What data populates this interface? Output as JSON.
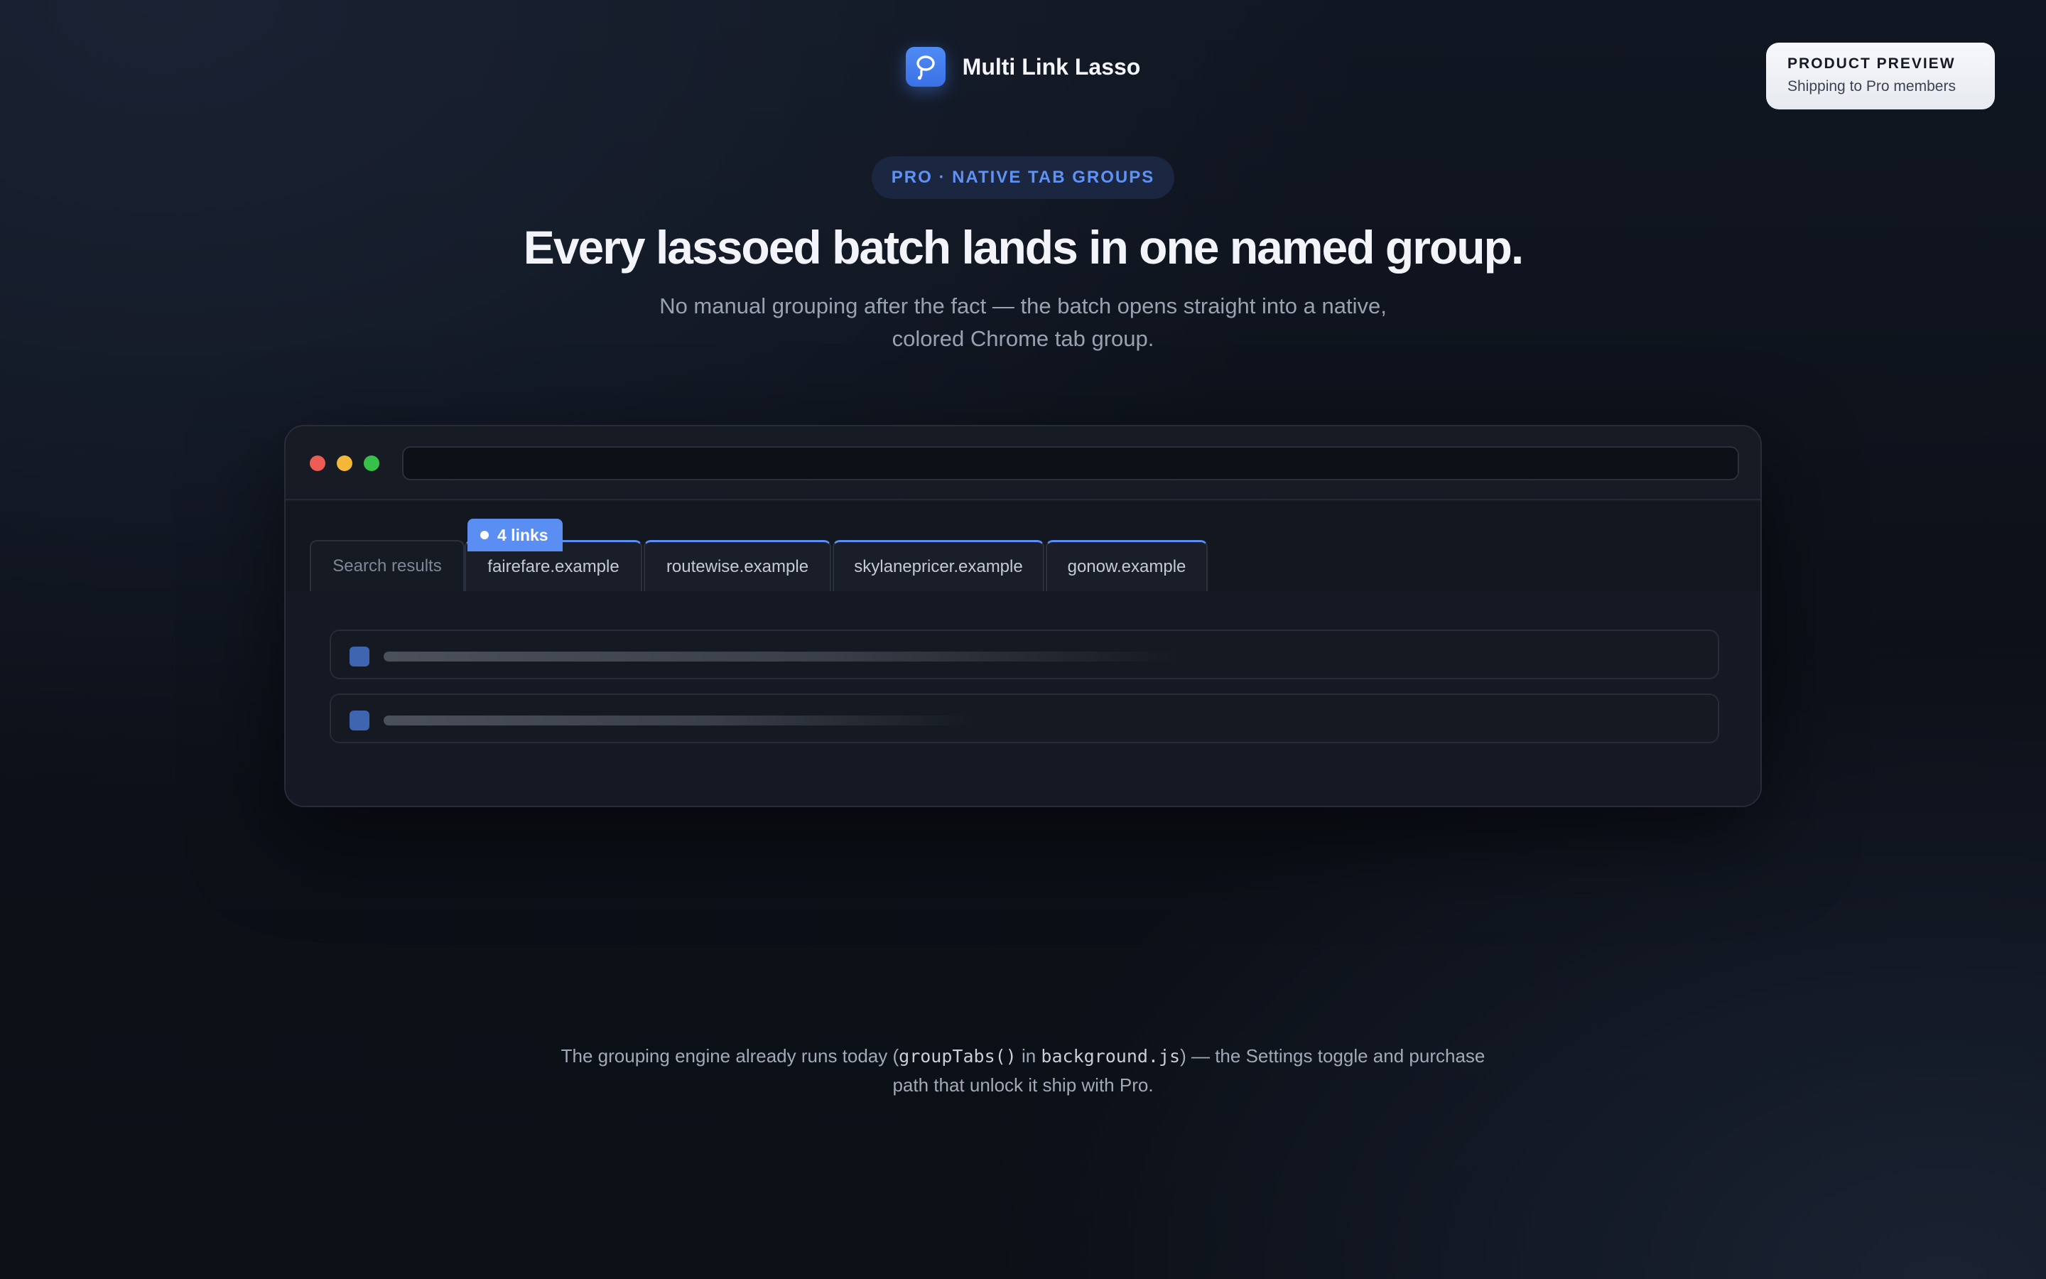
{
  "brand": {
    "name": "Multi Link Lasso",
    "logo_icon": "lasso-icon"
  },
  "preview_badge": {
    "title": "PRODUCT PREVIEW",
    "subtitle": "Shipping to Pro members"
  },
  "hero": {
    "pill": "PRO · NATIVE TAB GROUPS",
    "headline": "Every lassoed batch lands in one named group.",
    "subhead": "No manual grouping after the fact — the batch opens straight into a native, colored Chrome tab group."
  },
  "browser": {
    "tabs": [
      {
        "label": "Search results",
        "grouped": false
      },
      {
        "label": "fairefare.example",
        "grouped": true
      },
      {
        "label": "routewise.example",
        "grouped": true
      },
      {
        "label": "skylanepricer.example",
        "grouped": true
      },
      {
        "label": "gonow.example",
        "grouped": true
      }
    ],
    "group_chip": "4 links",
    "colors": {
      "group_accent": "#5b8ef2",
      "checkbox": "#3f64b0"
    }
  },
  "footer": {
    "prefix": "The grouping engine already runs today (",
    "code1": "groupTabs()",
    "mid": " in ",
    "code2": "background.js",
    "suffix": ") — the Settings toggle and purchase path that unlock it ship with Pro."
  }
}
